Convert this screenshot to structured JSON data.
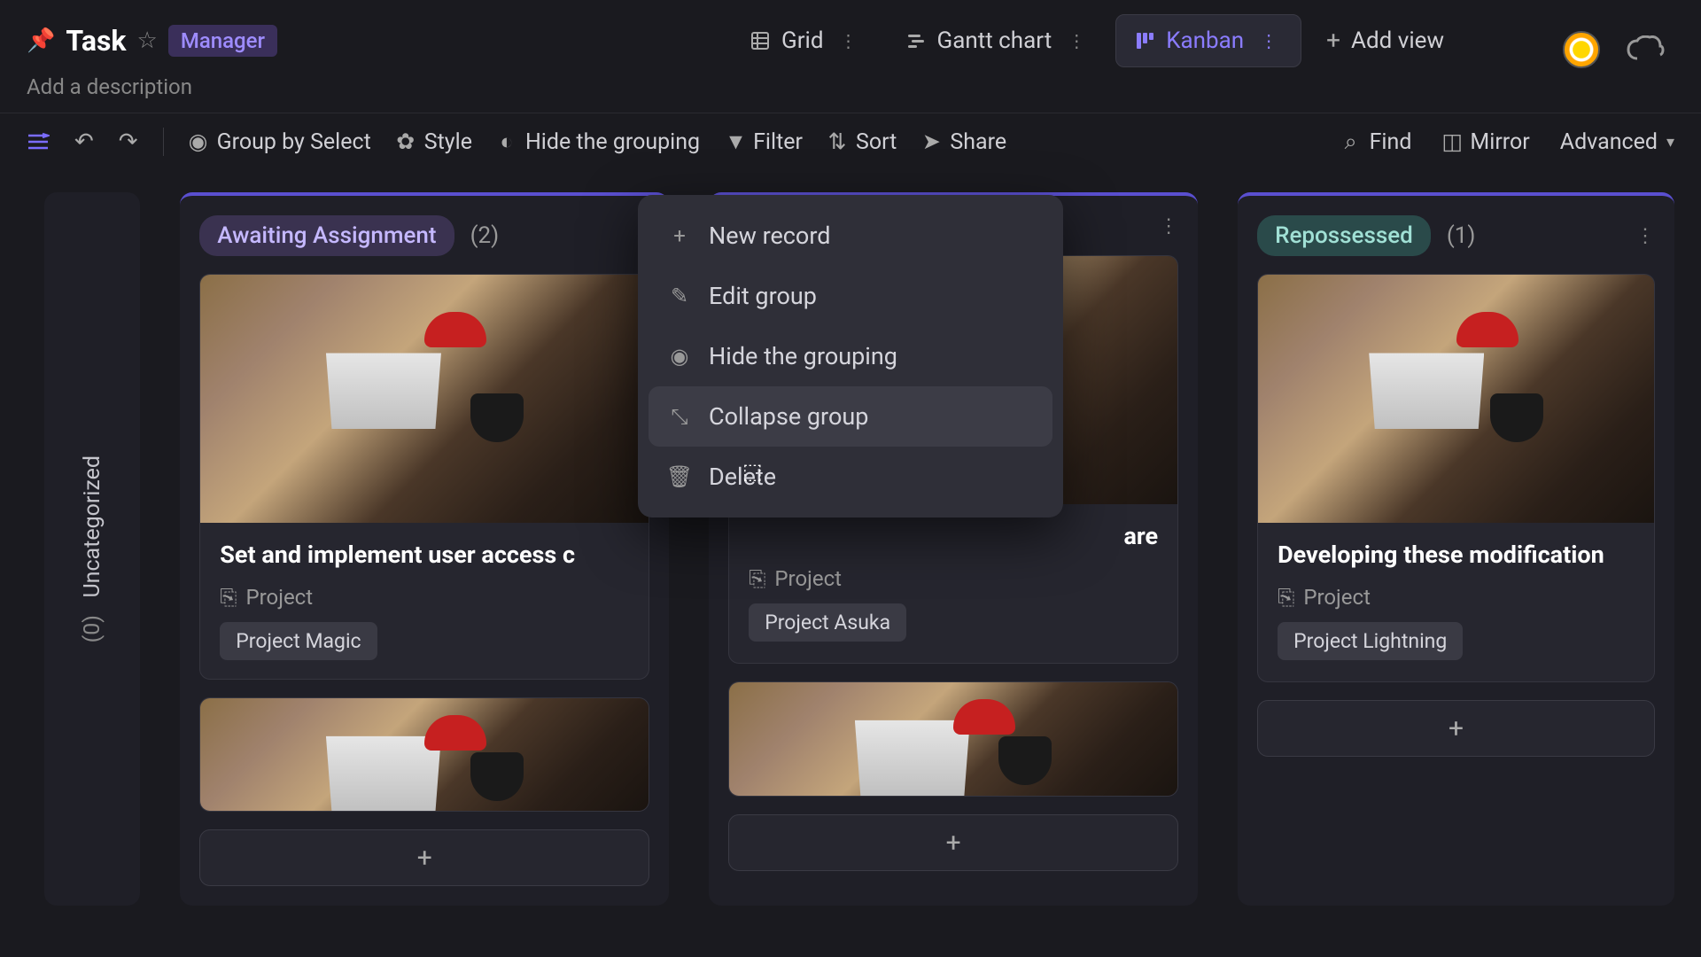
{
  "header": {
    "title": "Task",
    "badge": "Manager",
    "description_placeholder": "Add a description"
  },
  "views": {
    "grid": "Grid",
    "gantt": "Gantt chart",
    "kanban": "Kanban",
    "add": "Add view"
  },
  "toolbar": {
    "group_by": "Group by Select",
    "style": "Style",
    "hide_grouping": "Hide the grouping",
    "filter": "Filter",
    "sort": "Sort",
    "share": "Share",
    "find": "Find",
    "mirror": "Mirror",
    "advanced": "Advanced"
  },
  "columns": {
    "uncategorized": {
      "label": "Uncategorized",
      "count": "(0)"
    },
    "awaiting": {
      "label": "Awaiting Assignment",
      "count": "(2)"
    },
    "repossessed": {
      "label": "Repossessed",
      "count": "(1)"
    }
  },
  "cards": {
    "c1": {
      "title": "Set and implement user access c",
      "project_label": "Project",
      "tag": "Project Magic"
    },
    "c2": {
      "title_suffix": "are",
      "project_label": "Project",
      "tag": "Project Asuka"
    },
    "c3": {
      "title": "Developing these modification",
      "project_label": "Project",
      "tag": "Project Lightning"
    }
  },
  "context_menu": {
    "new_record": "New record",
    "edit_group": "Edit group",
    "hide_grouping": "Hide the grouping",
    "collapse_group": "Collapse group",
    "delete": "Delete"
  }
}
